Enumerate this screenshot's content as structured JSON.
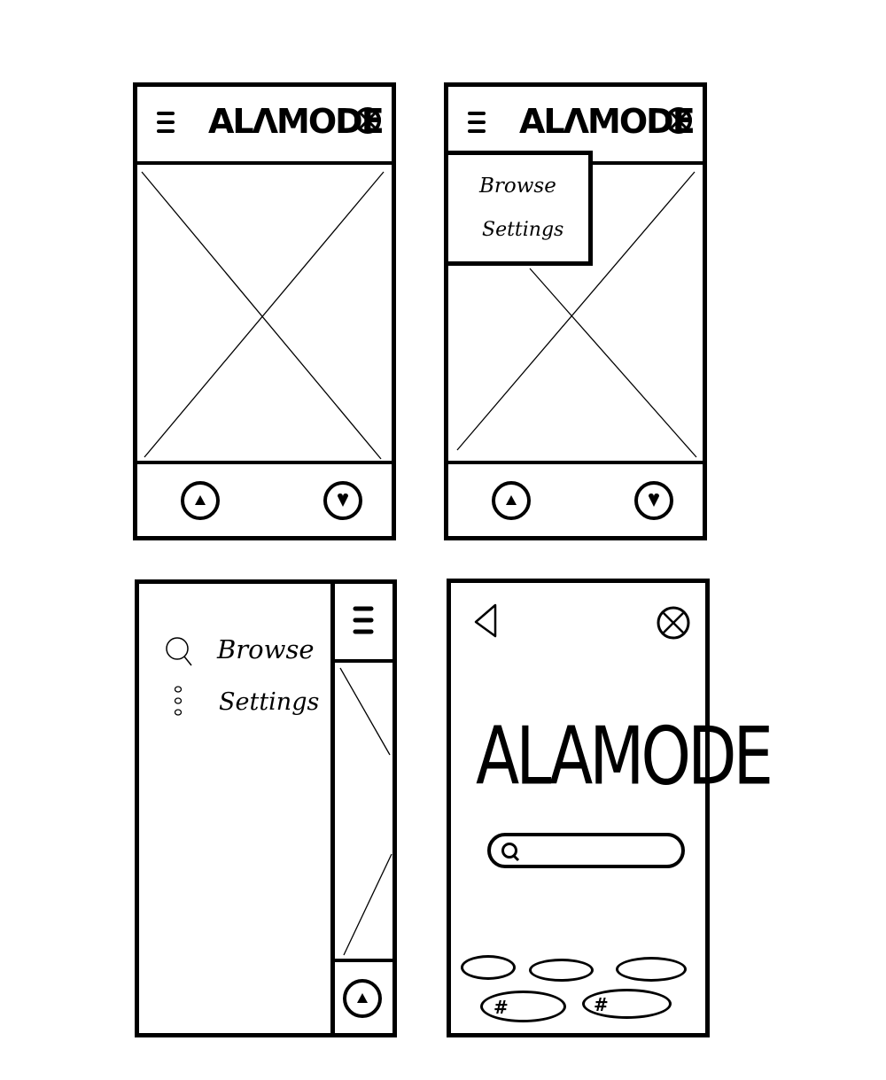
{
  "screens": {
    "home": {
      "logo": "ALΛMODE"
    },
    "menu_open": {
      "logo": "ALΛMODE",
      "menu_items": [
        "Browse",
        "Settings"
      ]
    },
    "sidebar": {
      "items": [
        {
          "label": "Browse",
          "icon": "search-icon"
        },
        {
          "label": "Settings",
          "icon": "dots-vertical-icon"
        }
      ]
    },
    "search": {
      "logo": "ALAMODE",
      "tags": [
        "",
        "",
        "",
        "#",
        "#"
      ]
    }
  }
}
